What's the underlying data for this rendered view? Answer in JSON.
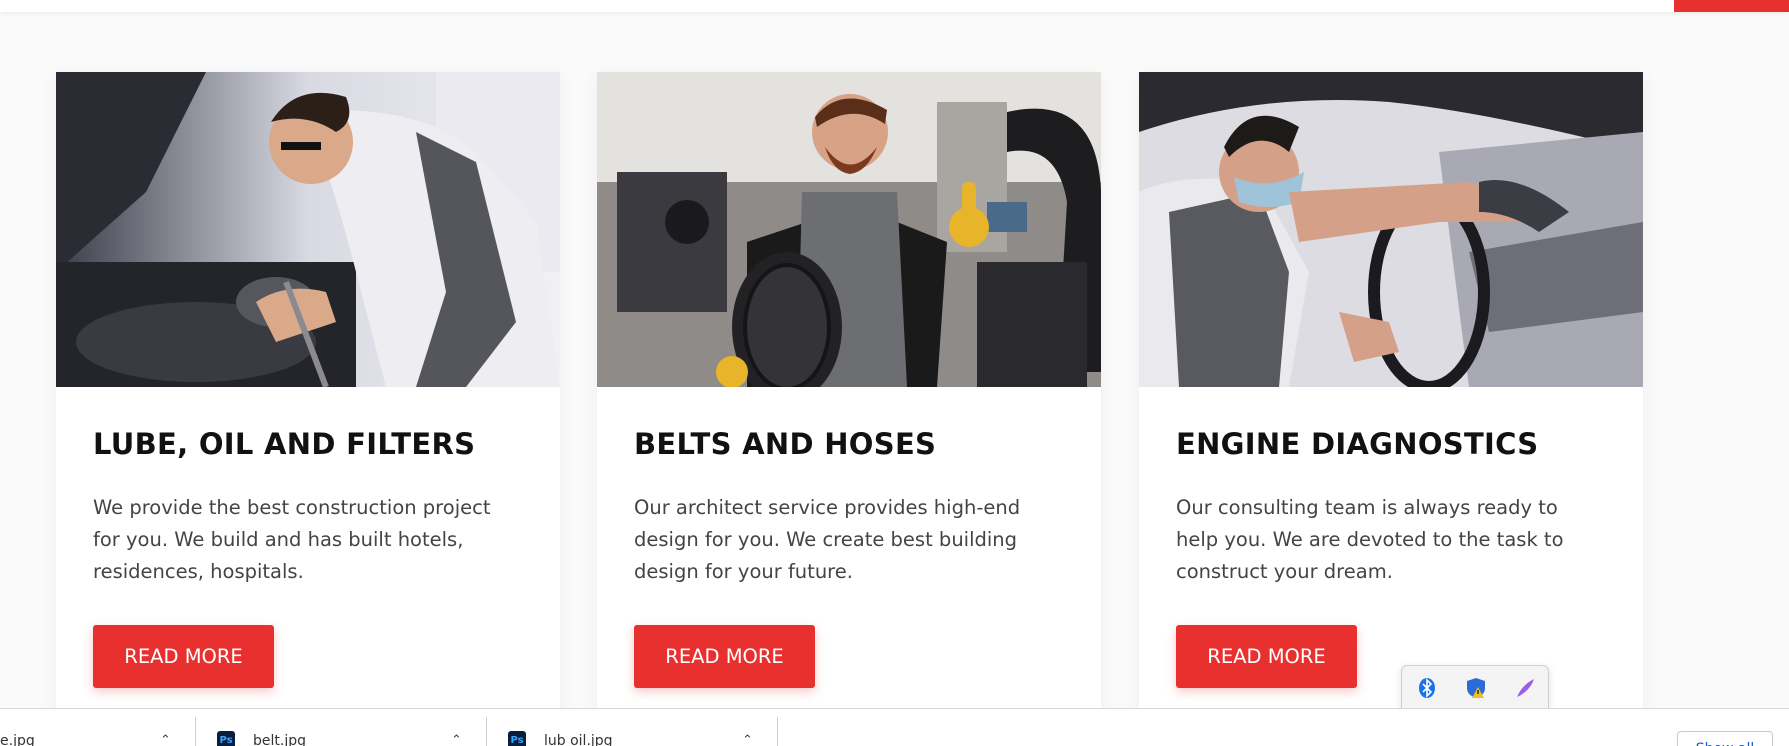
{
  "cards": [
    {
      "title": "LUBE, OIL AND FILTERS",
      "description": "We provide the best construction project for you. We build and has built hotels, residences, hospitals.",
      "button_label": "READ MORE"
    },
    {
      "title": "BELTS AND HOSES",
      "description": "Our architect service provides high-end design for you. We create best building design for your future.",
      "button_label": "READ MORE"
    },
    {
      "title": "ENGINE DIAGNOSTICS",
      "description": "Our consulting team is always ready to help you. We are devoted to the task to construct your dream.",
      "button_label": "READ MORE"
    }
  ],
  "downloads": {
    "items": [
      {
        "name": "e.jpg"
      },
      {
        "name": "belt.jpg",
        "icon": "Ps"
      },
      {
        "name": "lub oil.jpg",
        "icon": "Ps"
      }
    ],
    "show_all_label": "Show all"
  },
  "tray": {
    "icons": [
      "bluetooth-icon",
      "security-shield-icon",
      "pen-feather-icon",
      "network-icon",
      "teams-icon",
      "yellow-p-icon"
    ]
  },
  "colors": {
    "accent": "#e8302f",
    "title": "#111111",
    "text": "#444444"
  }
}
